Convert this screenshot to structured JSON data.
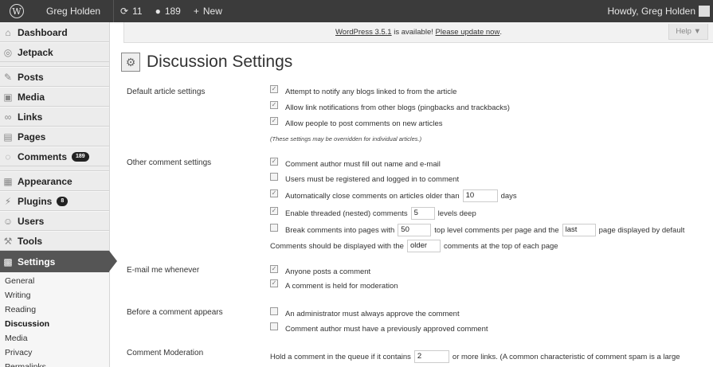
{
  "adminbar": {
    "site_name": "Greg Holden",
    "updates_count": "11",
    "comments_count": "189",
    "new_label": "New",
    "howdy": "Howdy, Greg Holden"
  },
  "sidebar": {
    "items": [
      {
        "label": "Dashboard",
        "icon": "home-icon"
      },
      {
        "label": "Jetpack",
        "icon": "jetpack-icon"
      },
      {
        "label": "Posts",
        "icon": "pin-icon"
      },
      {
        "label": "Media",
        "icon": "media-icon"
      },
      {
        "label": "Links",
        "icon": "link-icon"
      },
      {
        "label": "Pages",
        "icon": "page-icon"
      },
      {
        "label": "Comments",
        "icon": "comment-icon",
        "badge": "189"
      },
      {
        "label": "Appearance",
        "icon": "appearance-icon"
      },
      {
        "label": "Plugins",
        "icon": "plugin-icon",
        "badge": "8"
      },
      {
        "label": "Users",
        "icon": "users-icon"
      },
      {
        "label": "Tools",
        "icon": "tools-icon"
      },
      {
        "label": "Settings",
        "icon": "settings-icon"
      }
    ],
    "submenu": [
      "General",
      "Writing",
      "Reading",
      "Discussion",
      "Media",
      "Privacy",
      "Permalinks"
    ]
  },
  "notice": {
    "version_link": "WordPress 3.5.1",
    "middle": " is available! ",
    "update_link": "Please update now",
    "end": "."
  },
  "help_label": "Help ▼",
  "page_title": "Discussion Settings",
  "sections": {
    "default": {
      "label": "Default article settings",
      "opts": [
        "Attempt to notify any blogs linked to from the article",
        "Allow link notifications from other blogs (pingbacks and trackbacks)",
        "Allow people to post comments on new articles"
      ],
      "note": "(These settings may be overridden for individual articles.)"
    },
    "other": {
      "label": "Other comment settings",
      "opt1": "Comment author must fill out name and e-mail",
      "opt2": "Users must be registered and logged in to comment",
      "opt3_a": "Automatically close comments on articles older than",
      "opt3_val": "10",
      "opt3_b": "days",
      "opt4_a": "Enable threaded (nested) comments",
      "opt4_val": "5",
      "opt4_b": "levels deep",
      "opt5_a": "Break comments into pages with",
      "opt5_val": "50",
      "opt5_b": "top level comments per page and the",
      "opt5_sel": "last",
      "opt5_c": "page displayed by default",
      "order_a": "Comments should be displayed with the",
      "order_sel": "older",
      "order_b": "comments at the top of each page"
    },
    "email": {
      "label": "E-mail me whenever",
      "opt1": "Anyone posts a comment",
      "opt2": "A comment is held for moderation"
    },
    "before": {
      "label": "Before a comment appears",
      "opt1": "An administrator must always approve the comment",
      "opt2": "Comment author must have a previously approved comment"
    },
    "moderation": {
      "label": "Comment Moderation",
      "text_a": "Hold a comment in the queue if it contains",
      "val": "2",
      "text_b": "or more links. (A common characteristic of comment spam is a large"
    }
  }
}
